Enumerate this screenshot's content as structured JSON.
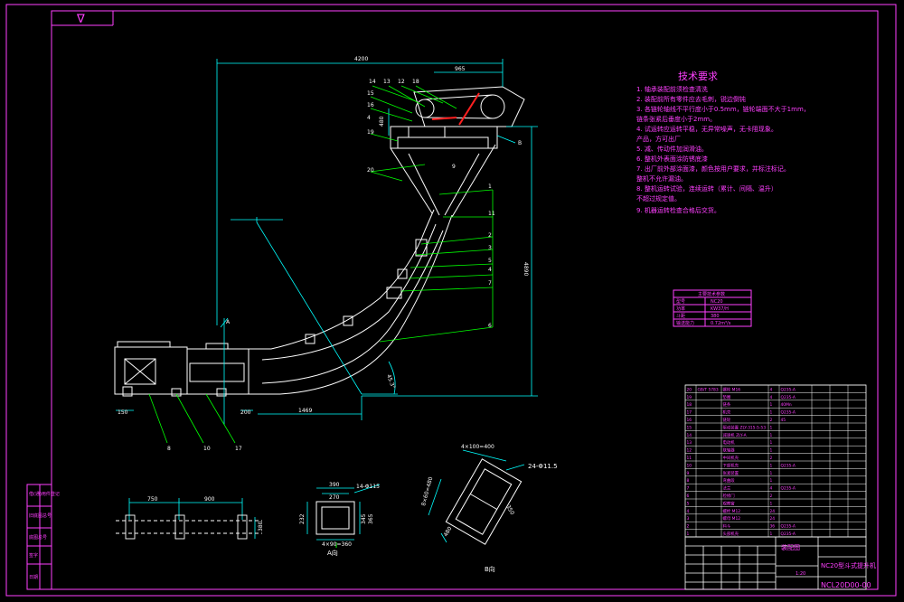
{
  "colors": {
    "background": "#000000",
    "frame": "#ff3fff",
    "geometry": "#ffffff",
    "dimension": "#00ffff",
    "leader": "#00ff00",
    "accent": "#ff2020"
  },
  "dimensions": {
    "total_width": "4200",
    "top_width": "965",
    "height": "4890",
    "base_left": "150",
    "base_mid": "200",
    "base_run": "1469",
    "angle": "45.3°",
    "side_small": "480",
    "plan_a": "750",
    "plan_b": "900",
    "plan_h": "380",
    "sec_w": "390",
    "sec_w2": "270",
    "sec_holes": "14-Φ115",
    "sec_bottom": "4×90=360",
    "sec_h": "232",
    "sec_h2": "345",
    "sec_h3": "365",
    "b_holes": "24-Φ11.5",
    "b_top": "4×100=400",
    "b_side": "8×60=480",
    "b_w": "350",
    "b_h": "480"
  },
  "part_callouts": [
    "14",
    "13",
    "12",
    "18",
    "15",
    "16",
    "4",
    "19",
    "20",
    "1",
    "11",
    "2",
    "3",
    "5",
    "4",
    "7",
    "6",
    "8",
    "10",
    "17",
    "9"
  ],
  "section_labels": {
    "a_arrow": "A",
    "b_arrow": "B",
    "a_view": "A向",
    "b_view": "B向",
    "rotated_view": "B向"
  },
  "tech_req": {
    "title": "技术要求",
    "items": [
      "1. 轴承装配前须检查清洗",
      "2. 装配前所有零件应去毛刺，锐边倒钝",
      "3. 各链轮轴线不平行度小于0.5mm，链轮端面不大于1mm，",
      "   链条张紧后垂度小于2mm。",
      "4. 试运转应运转平稳，无异常噪声，无卡阻现象。",
      "   产品，方可出厂",
      "5. 减、传动件加润滑油。",
      "6. 整机外表面涂防锈底漆",
      "7. 出厂前外部涂面漆，颜色按用户要求，并标注标记。",
      "   整机不允许漏油。",
      "8. 整机运转试验，连续运转（累计、间隔、温升）",
      "   不超过规定值。",
      "9. 机器运转检查合格后交货。"
    ]
  },
  "spec_table": {
    "title": "主要技术参数",
    "rows": [
      [
        "型号",
        "NC20"
      ],
      [
        "功率",
        "KW37/H"
      ],
      [
        "斗距",
        "380"
      ],
      [
        "输送能力",
        "0.72m³/s"
      ]
    ]
  },
  "parts_rows": [
    [
      "20",
      "GB/T 5783",
      "螺栓 M16",
      "4",
      "Q235-A",
      "",
      "",
      ""
    ],
    [
      "19",
      "",
      "垫圈",
      "4",
      "Q235-A",
      "",
      "",
      ""
    ],
    [
      "18",
      "",
      "链条",
      "1",
      "40Mn",
      "",
      "",
      ""
    ],
    [
      "17",
      "",
      "机壳",
      "1",
      "Q235-A",
      "",
      "",
      ""
    ],
    [
      "16",
      "",
      "链轮",
      "2",
      "45",
      "",
      "",
      ""
    ],
    [
      "15",
      "",
      "驱动装置 ZLY-315-5-53",
      "1",
      "",
      "",
      "",
      ""
    ],
    [
      "14",
      "",
      "减速机 ZLY-A",
      "1",
      "",
      "",
      "",
      ""
    ],
    [
      "13",
      "",
      "电动机",
      "1",
      "",
      "",
      "",
      ""
    ],
    [
      "12",
      "",
      "联轴器",
      "1",
      "",
      "",
      "",
      ""
    ],
    [
      "11",
      "",
      "中间机壳",
      "2",
      "",
      "",
      "",
      ""
    ],
    [
      "10",
      "",
      "下部机壳",
      "1",
      "Q235-A",
      "",
      "",
      ""
    ],
    [
      "9",
      "",
      "张紧装置",
      "1",
      "",
      "",
      "",
      ""
    ],
    [
      "8",
      "",
      "弯曲段",
      "1",
      "",
      "",
      "",
      ""
    ],
    [
      "7",
      "",
      "法兰",
      "4",
      "Q235-A",
      "",
      "",
      ""
    ],
    [
      "6",
      "",
      "检修门",
      "2",
      "",
      "",
      "",
      ""
    ],
    [
      "5",
      "",
      "观察窗",
      "1",
      "",
      "",
      "",
      ""
    ],
    [
      "4",
      "",
      "螺栓 M12",
      "24",
      "",
      "",
      "",
      ""
    ],
    [
      "3",
      "",
      "螺母 M12",
      "24",
      "",
      "",
      "",
      ""
    ],
    [
      "2",
      "",
      "料斗",
      "36",
      "Q235-A",
      "",
      "",
      ""
    ],
    [
      "1",
      "",
      "头部机壳",
      "1",
      "Q235-A",
      "",
      "",
      ""
    ]
  ],
  "title_block": {
    "drawing_name": "装配图",
    "machine_name": "NC20型斗式提升机",
    "drawing_no": "NCL20D00-00",
    "weight": "",
    "scale": "1:20"
  },
  "left_strip": [
    "借(通)用件登记",
    "旧底图总号",
    "底图总号",
    "签字",
    "日期"
  ],
  "corner_symbol": "∇"
}
